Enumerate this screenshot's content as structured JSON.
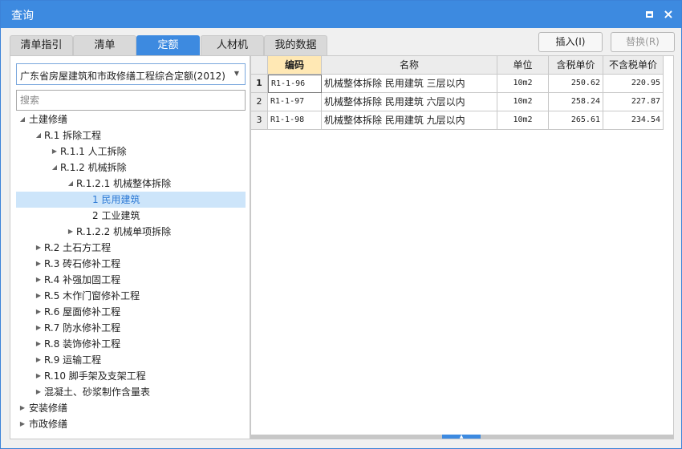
{
  "window": {
    "title": "查询"
  },
  "tabs": [
    {
      "label": "清单指引"
    },
    {
      "label": "清单"
    },
    {
      "label": "定额"
    },
    {
      "label": "人材机"
    },
    {
      "label": "我的数据"
    }
  ],
  "toolbar": {
    "insert_label": "插入(I)",
    "replace_label": "替换(R)"
  },
  "filter": {
    "selected_library": "广东省房屋建筑和市政修缮工程综合定额(2012)",
    "search_placeholder": "搜索"
  },
  "tree": [
    {
      "label": "土建修缮",
      "expanded": true
    },
    {
      "label": "R.1 拆除工程",
      "expanded": true
    },
    {
      "label": "R.1.1 人工拆除",
      "expanded": false
    },
    {
      "label": "R.1.2 机械拆除",
      "expanded": true
    },
    {
      "label": "R.1.2.1 机械整体拆除",
      "expanded": true
    },
    {
      "label": "1 民用建筑",
      "selected": true
    },
    {
      "label": "2 工业建筑"
    },
    {
      "label": "R.1.2.2 机械单项拆除",
      "expanded": false
    },
    {
      "label": "R.2 土石方工程",
      "expanded": false
    },
    {
      "label": "R.3 砖石修补工程",
      "expanded": false
    },
    {
      "label": "R.4 补强加固工程",
      "expanded": false
    },
    {
      "label": "R.5 木作门窗修补工程",
      "expanded": false
    },
    {
      "label": "R.6 屋面修补工程",
      "expanded": false
    },
    {
      "label": "R.7 防水修补工程",
      "expanded": false
    },
    {
      "label": "R.8 装饰修补工程",
      "expanded": false
    },
    {
      "label": "R.9 运输工程",
      "expanded": false
    },
    {
      "label": "R.10 脚手架及支架工程",
      "expanded": false
    },
    {
      "label": "混凝土、砂浆制作含量表",
      "expanded": false
    },
    {
      "label": "安装修缮",
      "expanded": false
    },
    {
      "label": "市政修缮",
      "expanded": false
    }
  ],
  "table": {
    "headers": [
      "编码",
      "名称",
      "单位",
      "含税单价",
      "不含税单价"
    ],
    "rows": [
      {
        "num": "1",
        "code": "R1-1-96",
        "name": "机械整体拆除 民用建筑 三层以内",
        "unit": "10m2",
        "price_tax": "250.62",
        "price_no_tax": "220.95"
      },
      {
        "num": "2",
        "code": "R1-1-97",
        "name": "机械整体拆除 民用建筑 六层以内",
        "unit": "10m2",
        "price_tax": "258.24",
        "price_no_tax": "227.87"
      },
      {
        "num": "3",
        "code": "R1-1-98",
        "name": "机械整体拆除 民用建筑 九层以内",
        "unit": "10m2",
        "price_tax": "265.61",
        "price_no_tax": "234.54"
      }
    ]
  },
  "colors": {
    "accent": "#3d8ae0",
    "selected_row_bg": "#cde5fa",
    "header_highlight": "#ffe8b4"
  },
  "icons": {
    "maximize": "maximize-icon",
    "close": "close-icon",
    "dropdown": "chevron-down-icon",
    "expanded": "triangle-down-icon",
    "collapsed": "triangle-right-icon"
  }
}
